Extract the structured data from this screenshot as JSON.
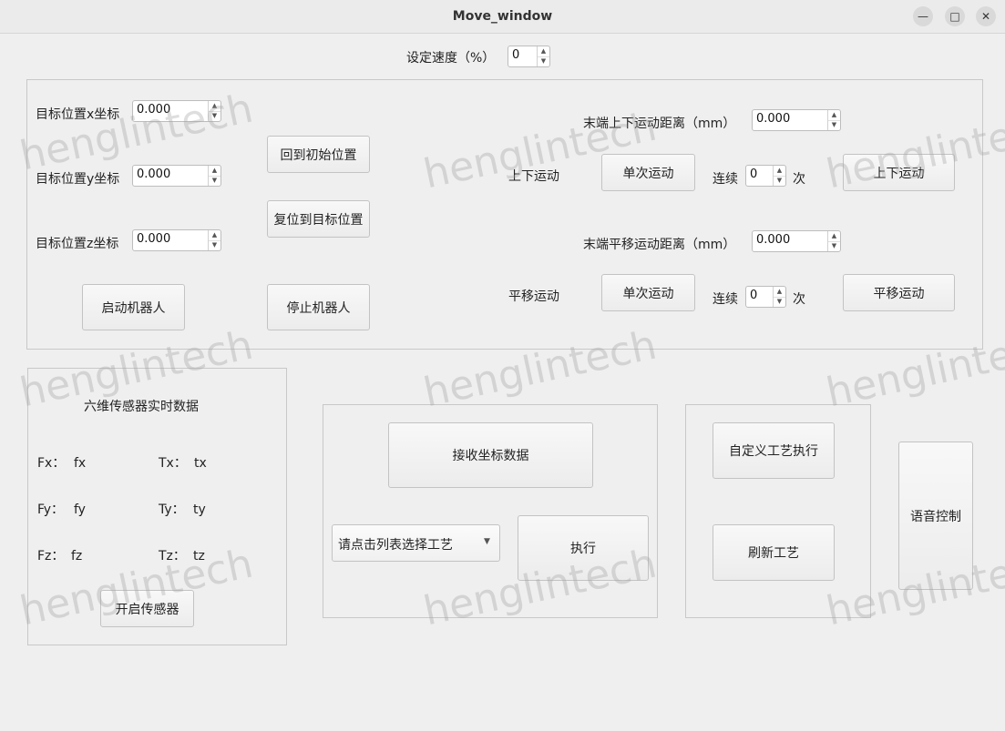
{
  "window": {
    "title": "Move_window"
  },
  "speed": {
    "label": "设定速度（%）",
    "value": "0"
  },
  "target": {
    "x_label": "目标位置x坐标",
    "x_value": "0.000",
    "y_label": "目标位置y坐标",
    "y_value": "0.000",
    "z_label": "目标位置z坐标",
    "z_value": "0.000",
    "home_button": "回到初始位置",
    "reset_button": "复位到目标位置",
    "start_button": "启动机器人",
    "stop_button": "停止机器人"
  },
  "vertical": {
    "distance_label": "末端上下运动距离（mm）",
    "distance_value": "0.000",
    "label": "上下运动",
    "single_button": "单次运动",
    "continuous_label": "连续",
    "count_value": "0",
    "times_label": "次",
    "run_button": "上下运动"
  },
  "translate": {
    "distance_label": "末端平移运动距离（mm）",
    "distance_value": "0.000",
    "label": "平移运动",
    "single_button": "单次运动",
    "continuous_label": "连续",
    "count_value": "0",
    "times_label": "次",
    "run_button": "平移运动"
  },
  "sensor": {
    "title": "六维传感器实时数据",
    "fx_label": "Fx：",
    "fx_value": "fx",
    "fy_label": "Fy：",
    "fy_value": "fy",
    "fz_label": "Fz：",
    "fz_value": "fz",
    "tx_label": "Tx：",
    "tx_value": "tx",
    "ty_label": "Ty：",
    "ty_value": "ty",
    "tz_label": "Tz：",
    "tz_value": "tz",
    "open_button": "开启传感器"
  },
  "process": {
    "receive_button": "接收坐标数据",
    "select_placeholder": "请点击列表选择工艺",
    "execute_button": "执行",
    "custom_button": "自定义工艺执行",
    "refresh_button": "刷新工艺"
  },
  "voice_button": "语音控制",
  "watermark": "henglintech"
}
